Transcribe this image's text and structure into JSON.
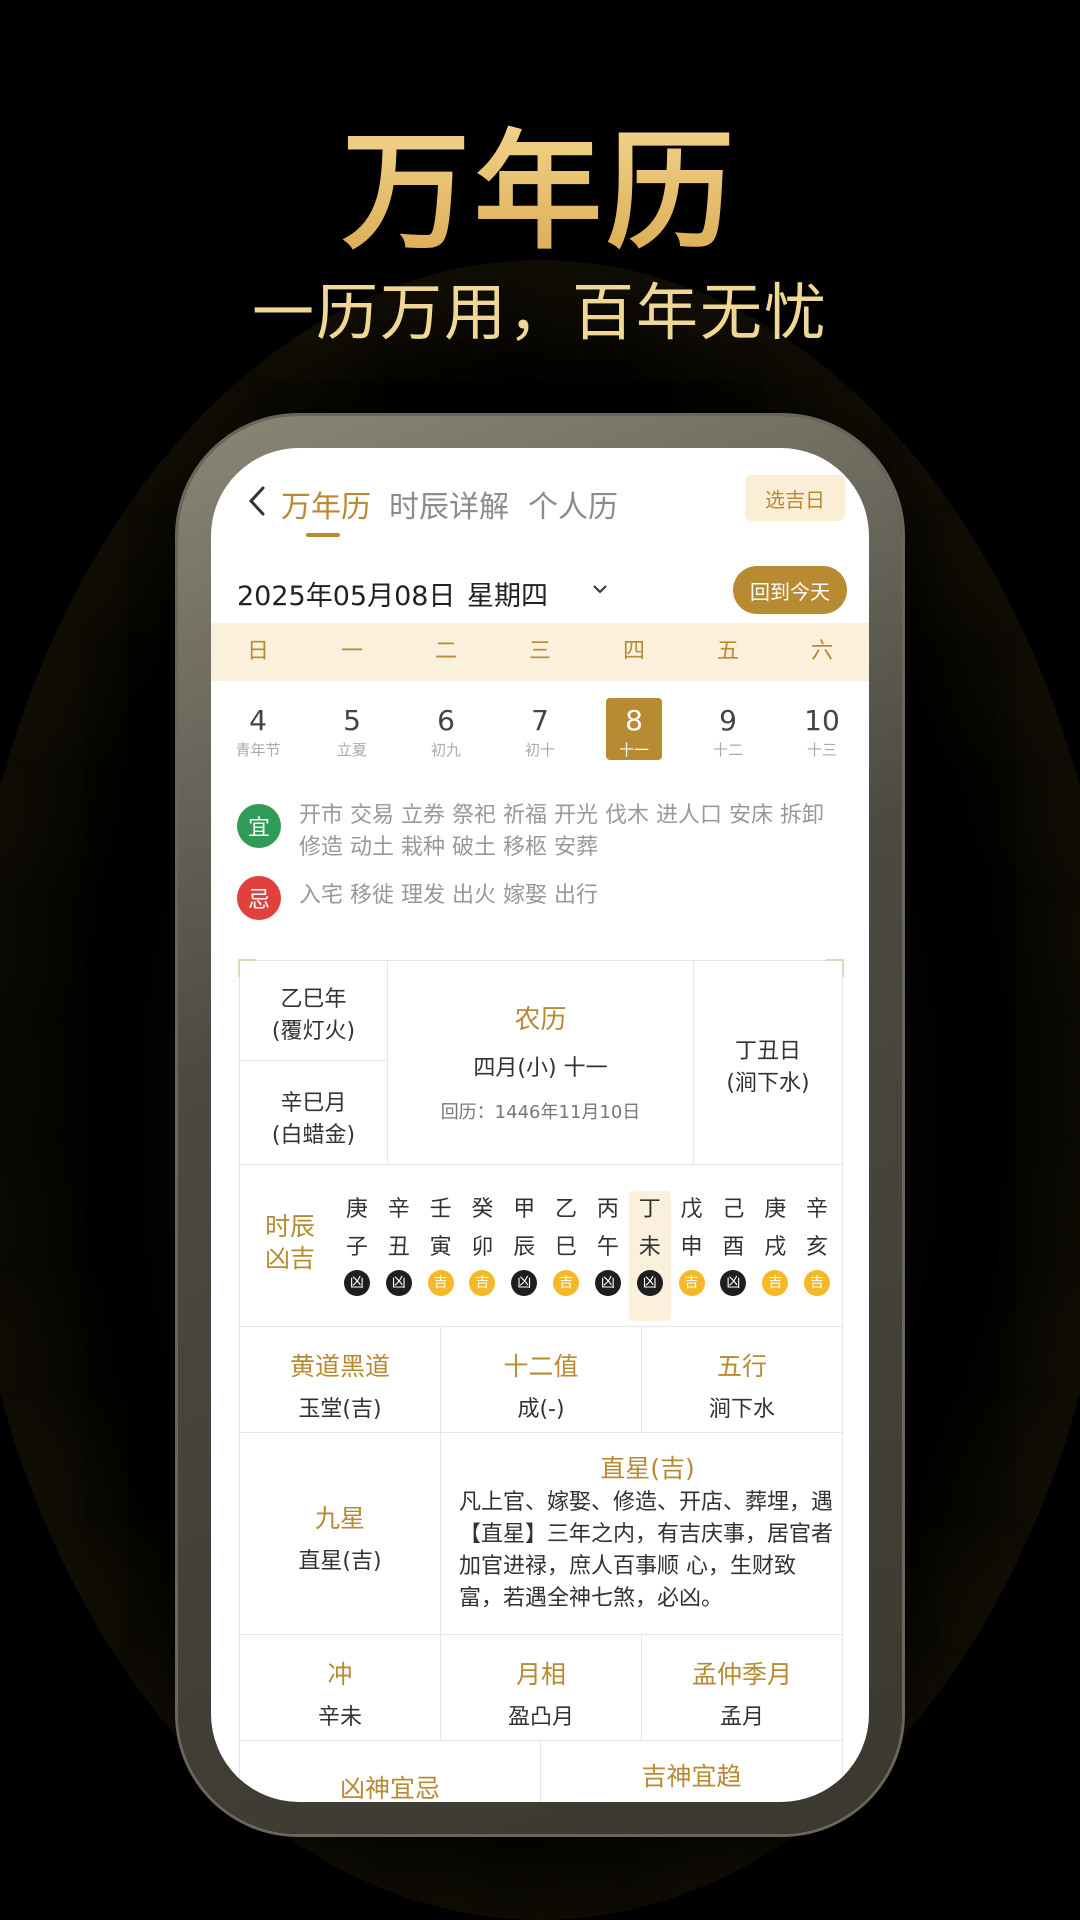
{
  "promo": {
    "title": "万年历",
    "subtitle": "一历万用，百年无忧"
  },
  "nav": {
    "tabs": [
      "万年历",
      "时辰详解",
      "个人历"
    ],
    "active_tab": 0,
    "pick_button": "选吉日"
  },
  "date_bar": {
    "date": "2025年05月08日",
    "weekday": "星期四",
    "today_button": "回到今天"
  },
  "week_header": [
    "日",
    "一",
    "二",
    "三",
    "四",
    "五",
    "六"
  ],
  "days": [
    {
      "num": "4",
      "sub": "青年节"
    },
    {
      "num": "5",
      "sub": "立夏"
    },
    {
      "num": "6",
      "sub": "初九"
    },
    {
      "num": "7",
      "sub": "初十"
    },
    {
      "num": "8",
      "sub": "十一",
      "selected": true
    },
    {
      "num": "9",
      "sub": "十二"
    },
    {
      "num": "10",
      "sub": "十三"
    }
  ],
  "yi": {
    "badge": "宜",
    "text": "开市 交易 立券 祭祀 祈福 开光 伐木 进人口 安床 拆卸 修造 动土 栽种 破土 移柩 安葬"
  },
  "ji": {
    "badge": "忌",
    "text": "入宅 移徙 理发 出火 嫁娶 出行"
  },
  "ganzhi": {
    "year": [
      "乙巳年",
      "(覆灯火)"
    ],
    "month": [
      "辛巳月",
      "(白蜡金)"
    ],
    "lunar_title": "农历",
    "lunar_date": "四月(小) 十一",
    "hijri": "回历：1446年11月10日",
    "day": [
      "丁丑日",
      "(涧下水)"
    ]
  },
  "hours": {
    "label": [
      "时辰",
      "凶吉"
    ],
    "stems": [
      "庚",
      "辛",
      "壬",
      "癸",
      "甲",
      "乙",
      "丙",
      "丁",
      "戊",
      "己",
      "庚",
      "辛"
    ],
    "branches": [
      "子",
      "丑",
      "寅",
      "卯",
      "辰",
      "巳",
      "午",
      "未",
      "申",
      "酉",
      "戌",
      "亥"
    ],
    "luck": [
      "凶",
      "凶",
      "吉",
      "吉",
      "凶",
      "吉",
      "凶",
      "凶",
      "吉",
      "凶",
      "吉",
      "吉"
    ],
    "current_index": 7
  },
  "row3": [
    {
      "title": "黄道黑道",
      "value": "玉堂(吉)"
    },
    {
      "title": "十二值",
      "value": "成(-)"
    },
    {
      "title": "五行",
      "value": "涧下水"
    }
  ],
  "star": {
    "title": "九星",
    "value": "直星(吉)",
    "detail_title": "直星(吉)",
    "detail": "凡上官、嫁娶、修造、开店、葬埋，遇【直星】三年之内，有吉庆事，居官者加官进禄，庶人百事顺 心，生财致富，若遇全神七煞，必凶。"
  },
  "row5": [
    {
      "title": "冲",
      "value": "辛未"
    },
    {
      "title": "月相",
      "value": "盈凸月"
    },
    {
      "title": "孟仲季月",
      "value": "孟月"
    }
  ],
  "row6": [
    "凶神宜忌",
    "吉神宜趋"
  ],
  "colors": {
    "gold": "#b88a32",
    "yi_green": "#2f9b57",
    "ji_red": "#e0413d",
    "ji_pill": "#f5b829"
  }
}
